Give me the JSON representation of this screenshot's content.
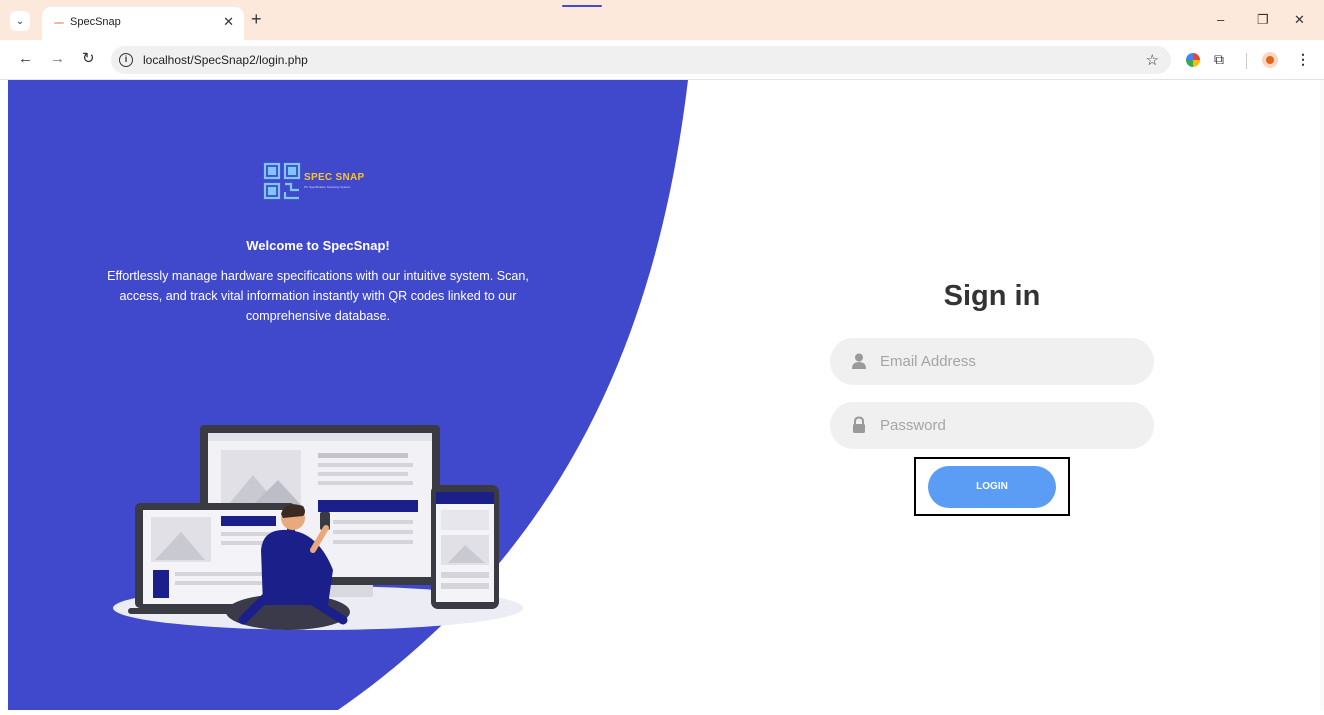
{
  "browser": {
    "tab_title": "SpecSnap",
    "url": "localhost/SpecSnap2/login.php",
    "icons": {
      "tab_menu": "chevron-down-icon",
      "tab_close": "close-icon",
      "new_tab": "plus-icon",
      "back": "arrow-left-icon",
      "forward": "arrow-right-icon",
      "reload": "reload-icon",
      "site_info": "info-icon",
      "bookmark": "star-icon",
      "extensions": "puzzle-icon",
      "profile": "profile-icon",
      "menu": "kebab-icon",
      "minimize": "minimize-icon",
      "restore": "restore-icon",
      "close": "close-window-icon"
    }
  },
  "hero": {
    "logo_title": "SPEC SNAP",
    "logo_subtitle": "PC Specification Scanning System",
    "welcome": "Welcome to SpecSnap!",
    "description": "Effortlessly manage hardware specifications with our intuitive system. Scan, access, and track vital information instantly with QR codes linked to our comprehensive database."
  },
  "signin": {
    "title": "Sign in",
    "email_placeholder": "Email Address",
    "password_placeholder": "Password",
    "login_label": "LOGIN"
  },
  "colors": {
    "panel_blue": "#4049cc",
    "login_button": "#5b9cf4",
    "logo_yellow": "#f5c33b",
    "chrome_bg": "#fde8dc"
  }
}
